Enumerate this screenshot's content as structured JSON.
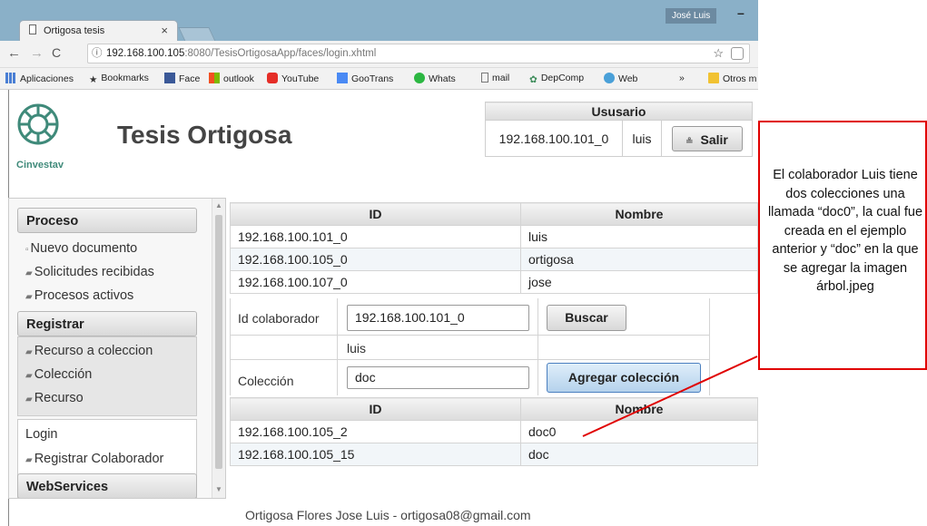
{
  "browser": {
    "tab_title": "Ortigosa tesis",
    "tab_close": "×",
    "user_badge": "José Luis",
    "minimize": "–",
    "url_host": "192.168.100.105",
    "url_rest": ":8080/TesisOrtigosaApp/faces/login.xhtml",
    "bookmarks": [
      "Aplicaciones",
      "Bookmarks",
      "Face",
      "outlook",
      "YouTube",
      "GooTrans",
      "Whats",
      "mail",
      "DepComp",
      "Web",
      "»",
      "Otros m"
    ]
  },
  "header": {
    "logo_text": "Cinvestav",
    "title": "Tesis Ortigosa",
    "user_table_title": "Ususario",
    "user_id": "192.168.100.101_0",
    "user_name": "luis",
    "logout_label": "Salir"
  },
  "sidebar": {
    "proceso": "Proceso",
    "proceso_items": [
      "Nuevo documento",
      "Solicitudes recibidas",
      "Procesos activos"
    ],
    "registrar": "Registrar",
    "registrar_items": [
      "Recurso a coleccion",
      "Colección",
      "Recurso"
    ],
    "login": "Login",
    "login_items": [
      "Registrar Colaborador"
    ],
    "webservices": "WebServices"
  },
  "collaborators": {
    "col_id": "ID",
    "col_name": "Nombre",
    "rows": [
      {
        "id": "192.168.100.101_0",
        "name": "luis"
      },
      {
        "id": "192.168.100.105_0",
        "name": "ortigosa"
      },
      {
        "id": "192.168.100.107_0",
        "name": "jose"
      }
    ]
  },
  "form": {
    "id_label": "Id colaborador",
    "id_value": "192.168.100.101_0",
    "search_label": "Buscar",
    "found_name": "luis",
    "collection_label": "Colección",
    "collection_value": "doc",
    "add_label": "Agregar colección"
  },
  "collections": {
    "col_id": "ID",
    "col_name": "Nombre",
    "rows": [
      {
        "id": "192.168.100.105_2",
        "name": "doc0"
      },
      {
        "id": "192.168.100.105_15",
        "name": "doc"
      }
    ]
  },
  "footer": "Ortigosa Flores Jose Luis - ortigosa08@gmail.com",
  "callout": "El colaborador Luis tiene dos colecciones una llamada “doc0”, la cual fue creada en el ejemplo anterior y “doc” en la que se agregar la imagen árbol.jpeg",
  "colors": {
    "callout_border": "#e00000",
    "annotation_line": "#e00000",
    "titlebar": "#8ab0c8"
  }
}
